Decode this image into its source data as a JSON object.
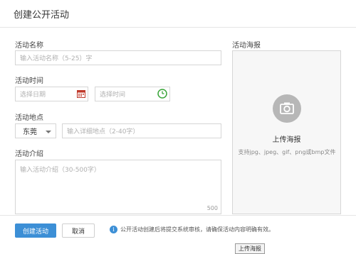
{
  "dialog": {
    "title": "创建公开活动"
  },
  "form": {
    "name": {
      "label": "活动名称",
      "placeholder": "输入活动名称（5-25）字"
    },
    "time": {
      "label": "活动时间",
      "date_placeholder": "选择日期",
      "time_placeholder": "选择时间",
      "date_icon": "calendar-icon",
      "time_icon": "clock-icon"
    },
    "location": {
      "label": "活动地点",
      "city_value": "东莞",
      "detail_placeholder": "输入详细地点（2-40字）"
    },
    "intro": {
      "label": "活动介绍",
      "placeholder": "输入活动介绍（30-500字）",
      "counter": "500"
    }
  },
  "poster": {
    "label": "活动海报",
    "upload_title": "上传海报",
    "hint": "支持jpg、jpeg、gif、png或bmp文件",
    "upload_button": "上传海报",
    "icon": "camera-icon"
  },
  "footer": {
    "create_label": "创建活动",
    "cancel_label": "取消",
    "notice": "公开活动创建后将提交系统审核，请确保活动内容明确有效。",
    "notice_icon": "info-icon"
  },
  "colors": {
    "primary": "#3c8fd6",
    "calendar": "#c0392b",
    "clock": "#3aa53a"
  }
}
